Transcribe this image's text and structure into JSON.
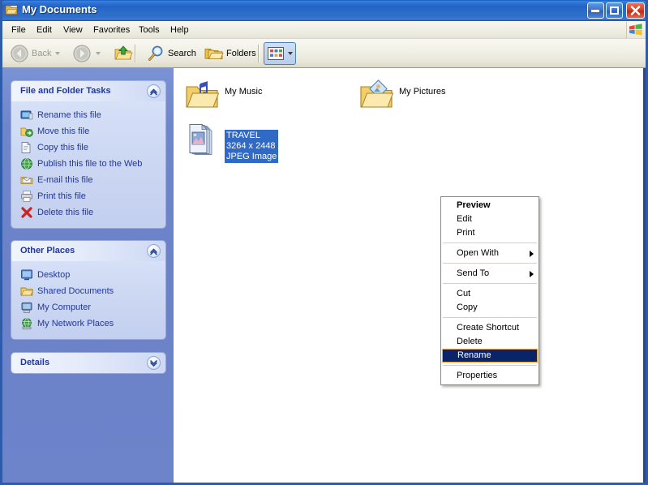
{
  "window": {
    "title": "My Documents",
    "title_icon": "folder-documents-icon",
    "caption": {
      "minimize": "minimize-button",
      "maximize": "maximize-button",
      "close": "close-button"
    }
  },
  "menubar": {
    "items": [
      {
        "label": "File"
      },
      {
        "label": "Edit"
      },
      {
        "label": "View"
      },
      {
        "label": "Favorites"
      },
      {
        "label": "Tools"
      },
      {
        "label": "Help"
      }
    ],
    "brand_icon": "windows-flag-icon"
  },
  "toolbar": {
    "back": {
      "label": "Back",
      "icon": "back-arrow-icon",
      "disabled": true
    },
    "forward": {
      "icon": "forward-arrow-icon",
      "disabled": true
    },
    "up": {
      "icon": "up-folder-icon"
    },
    "search": {
      "label": "Search",
      "icon": "search-icon"
    },
    "folders": {
      "label": "Folders",
      "icon": "folders-icon"
    },
    "views": {
      "icon": "views-grid-icon"
    }
  },
  "sidebar": {
    "panels": [
      {
        "title": "File and Folder Tasks",
        "collapsed": false,
        "chevron": "chevron-up-icon",
        "items": [
          {
            "label": "Rename this file",
            "icon": "rename-icon"
          },
          {
            "label": "Move this file",
            "icon": "move-icon"
          },
          {
            "label": "Copy this file",
            "icon": "copy-icon"
          },
          {
            "label": "Publish this file to the Web",
            "icon": "publish-web-icon"
          },
          {
            "label": "E-mail this file",
            "icon": "email-icon"
          },
          {
            "label": "Print this file",
            "icon": "print-icon"
          },
          {
            "label": "Delete this file",
            "icon": "delete-x-icon"
          }
        ]
      },
      {
        "title": "Other Places",
        "collapsed": false,
        "chevron": "chevron-up-icon",
        "items": [
          {
            "label": "Desktop",
            "icon": "desktop-icon"
          },
          {
            "label": "Shared Documents",
            "icon": "shared-folder-icon"
          },
          {
            "label": "My Computer",
            "icon": "my-computer-icon"
          },
          {
            "label": "My Network Places",
            "icon": "network-places-icon"
          }
        ]
      },
      {
        "title": "Details",
        "collapsed": true,
        "chevron": "chevron-down-icon",
        "items": []
      }
    ]
  },
  "content": {
    "items": [
      {
        "name": "My Music",
        "icon": "folder-music-icon",
        "selected": false,
        "type": "folder"
      },
      {
        "name": "My Pictures",
        "icon": "folder-pictures-icon",
        "selected": false,
        "type": "folder"
      },
      {
        "name": "TRAVEL",
        "dimensions": "3264 x 2448",
        "filetype": "JPEG Image",
        "icon": "jpeg-image-icon",
        "selected": true,
        "type": "file"
      }
    ]
  },
  "context_menu": {
    "groups": [
      [
        {
          "label": "Preview",
          "bold": true,
          "selected": false,
          "submenu": false
        },
        {
          "label": "Edit",
          "bold": false,
          "selected": false,
          "submenu": false
        },
        {
          "label": "Print",
          "bold": false,
          "selected": false,
          "submenu": false
        }
      ],
      [
        {
          "label": "Open With",
          "bold": false,
          "selected": false,
          "submenu": true
        }
      ],
      [
        {
          "label": "Send To",
          "bold": false,
          "selected": false,
          "submenu": true
        }
      ],
      [
        {
          "label": "Cut",
          "bold": false,
          "selected": false,
          "submenu": false
        },
        {
          "label": "Copy",
          "bold": false,
          "selected": false,
          "submenu": false
        }
      ],
      [
        {
          "label": "Create Shortcut",
          "bold": false,
          "selected": false,
          "submenu": false
        },
        {
          "label": "Delete",
          "bold": false,
          "selected": false,
          "submenu": false
        },
        {
          "label": "Rename",
          "bold": false,
          "selected": true,
          "submenu": false
        }
      ],
      [
        {
          "label": "Properties",
          "bold": false,
          "selected": false,
          "submenu": false
        }
      ]
    ]
  },
  "colors": {
    "titlebar_blue": "#2d72d4",
    "sidebar_blue": "#6b81c8",
    "panel_body": "#cdd8f3",
    "link_text": "#21379b",
    "selection_blue": "#316ac5",
    "menu_highlight": "#0a246a",
    "menu_highlight_border": "#ff9933",
    "close_red": "#d9432a",
    "window_border": "#2f5bab"
  }
}
